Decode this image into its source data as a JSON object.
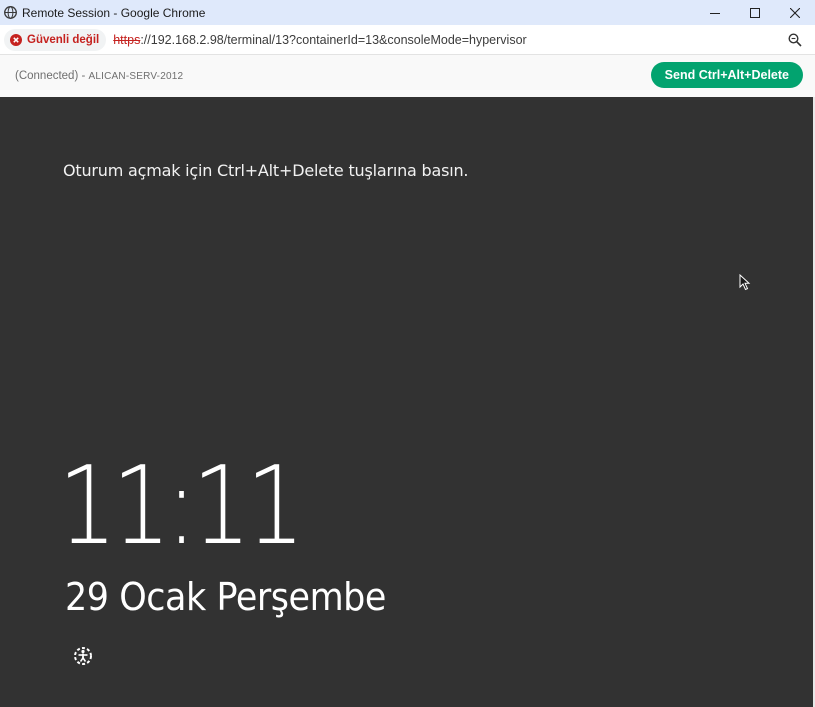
{
  "window": {
    "title": "Remote Session - Google Chrome",
    "icon": "globe-icon",
    "controls": [
      "minimize",
      "maximize",
      "close"
    ]
  },
  "addressbar": {
    "security_label": "Güvenli değil",
    "url_scheme": "https",
    "url_rest": "://192.168.2.98/terminal/13?containerId=13&consoleMode=hypervisor",
    "warning_color": "#c5221f"
  },
  "header": {
    "status": "(Connected) - ",
    "server": "ALICAN-SERV-2012",
    "send_button": "Send Ctrl+Alt+Delete",
    "accent": "#02a36f"
  },
  "remote": {
    "prompt": "Oturum açmak için Ctrl+Alt+Delete tuşlarına basın.",
    "time": "11:11",
    "date": "29 Ocak Perşembe",
    "background": "#323232"
  }
}
